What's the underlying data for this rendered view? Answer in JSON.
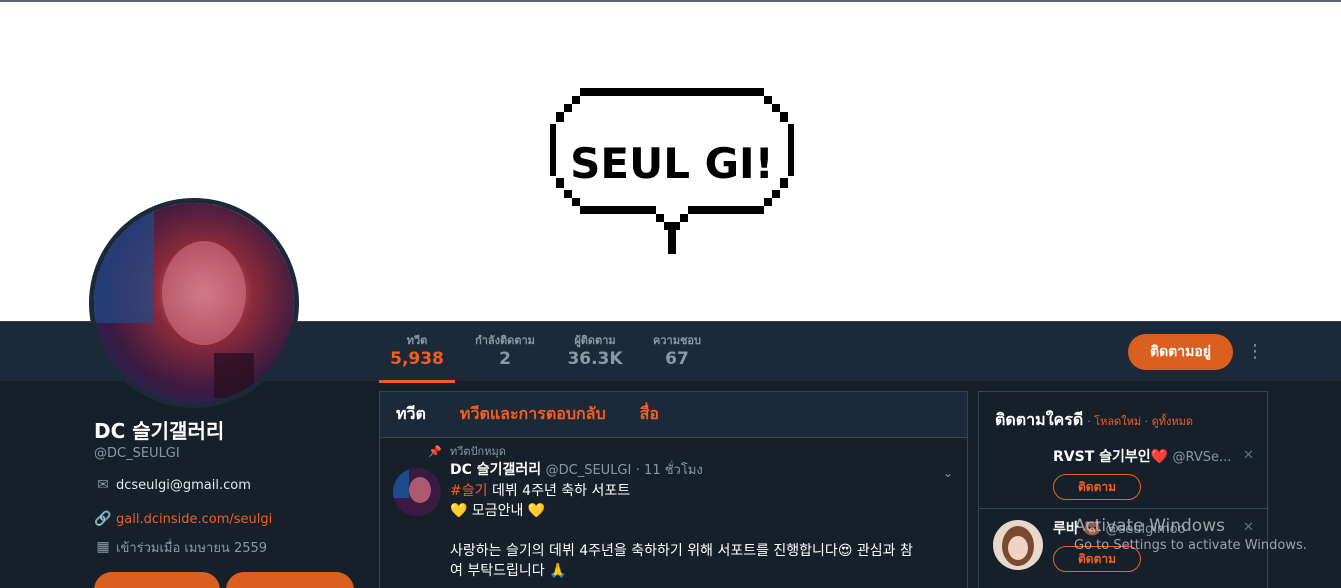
{
  "banner": {
    "speech_text": "SEUL GI!"
  },
  "stats": [
    {
      "label": "ทวีต",
      "value": "5,938"
    },
    {
      "label": "กำลังติดตาม",
      "value": "2"
    },
    {
      "label": "ผู้ติดตาม",
      "value": "36.3K"
    },
    {
      "label": "ความชอบ",
      "value": "67"
    }
  ],
  "actions": {
    "following_label": "ติดตามอยู่",
    "more_icon": "more-vertical-icon"
  },
  "profile": {
    "name": "DC 슬기갤러리",
    "handle": "@DC_SEULGI",
    "email": "dcseulgi@gmail.com",
    "website": "gall.dcinside.com/seulgi",
    "joined": "เข้าร่วมเมื่อ เมษายน 2559"
  },
  "timeline": {
    "tabs": [
      "ทวีต",
      "ทวีตและการตอบกลับ",
      "สื่อ"
    ],
    "pinned_label": "ทวีตปักหมุด",
    "tweet": {
      "name": "DC 슬기갤러리",
      "handle": "@DC_SEULGI",
      "time": "· 11 ชั่วโมง",
      "hashtag": "#슬기",
      "line1": " 데뷔 4주년 축하 서포트",
      "line2": "💛 모금안내 💛",
      "line3": "사랑하는 슬기의 데뷔 4주년을 축하하기 위해 서포트를 진행합니다😍 관심과 참",
      "line4": "여 부탁드립니다 🙏"
    }
  },
  "sidebar": {
    "title": "ติดตามใครดี",
    "sep1": " · ",
    "refresh": "โหลดใหม่",
    "sep2": " · ",
    "view_all": "ดูทั้งหมด",
    "suggestions": [
      {
        "name": "RVST 슬기부인❤️",
        "handle": "@RVSe...",
        "button": "ติดตาม"
      },
      {
        "name": "루바 🐻",
        "handle": "@seulgimoo",
        "button": "ติดตาม"
      }
    ]
  },
  "watermark": {
    "line1": "Activate Windows",
    "line2": "Go to Settings to activate Windows."
  },
  "colors": {
    "accent": "#f45d22",
    "background": "#15202b",
    "navbar": "#1c2938"
  }
}
